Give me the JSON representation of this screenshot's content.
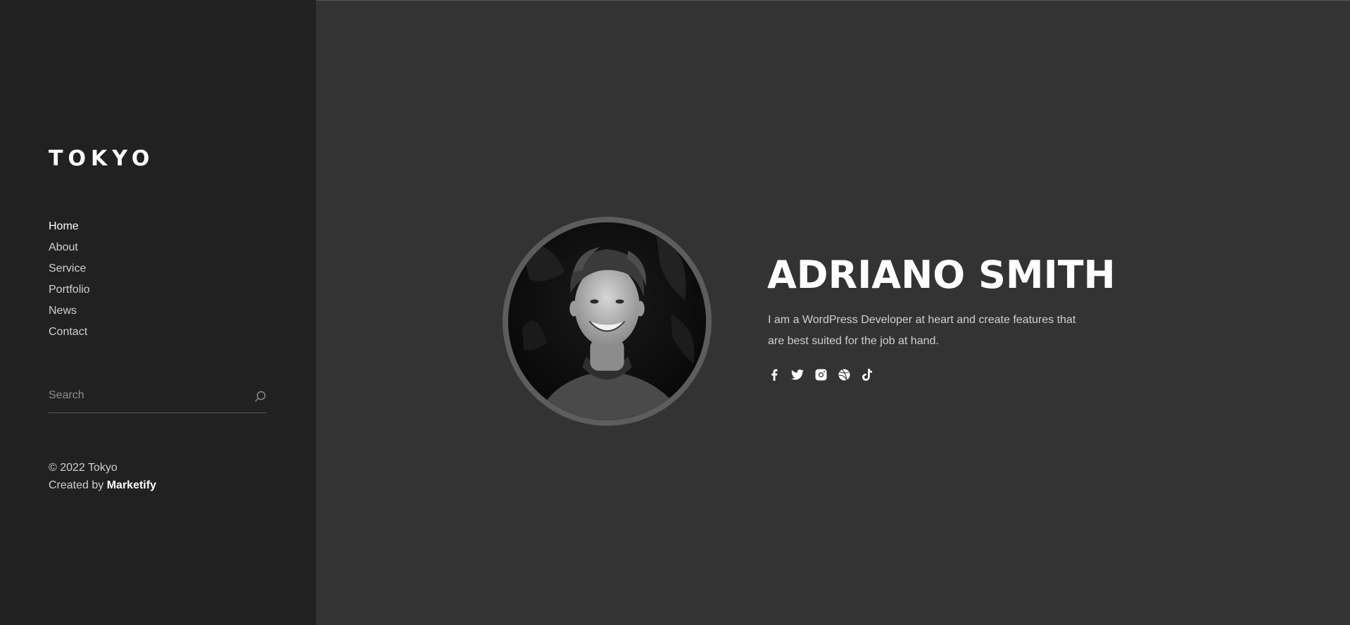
{
  "sidebar": {
    "logo": "TOKYO",
    "nav": [
      {
        "label": "Home",
        "active": true
      },
      {
        "label": "About",
        "active": false
      },
      {
        "label": "Service",
        "active": false
      },
      {
        "label": "Portfolio",
        "active": false
      },
      {
        "label": "News",
        "active": false
      },
      {
        "label": "Contact",
        "active": false
      }
    ],
    "search": {
      "placeholder": "Search",
      "value": ""
    },
    "copyright": {
      "line1": "© 2022 Tokyo",
      "created_prefix": "Created by ",
      "created_brand": "Marketify"
    }
  },
  "hero": {
    "name": "ADRIANO SMITH",
    "description": "I am a WordPress Developer at heart and create features that are best suited for the job at hand.",
    "socials": [
      {
        "icon": "facebook-icon"
      },
      {
        "icon": "twitter-icon"
      },
      {
        "icon": "instagram-icon"
      },
      {
        "icon": "dribbble-icon"
      },
      {
        "icon": "tiktok-icon"
      }
    ]
  },
  "colors": {
    "sidebar_bg": "#212121",
    "main_bg": "#333333",
    "text_primary": "#ffffff",
    "text_secondary": "#cfcfcf"
  }
}
